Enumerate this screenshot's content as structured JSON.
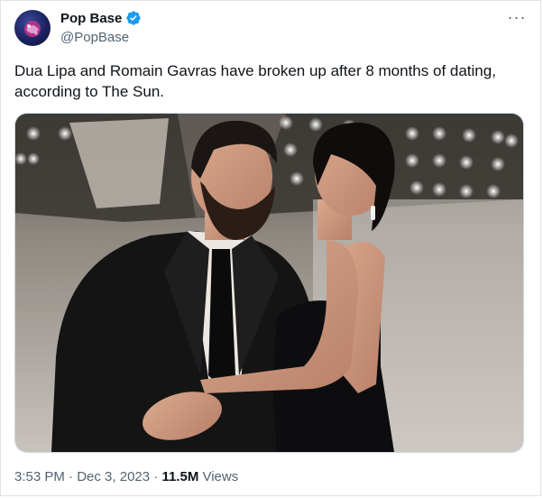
{
  "author": {
    "display_name": "Pop Base",
    "handle": "@PopBase",
    "verified": true,
    "verified_color": "#1d9bf0"
  },
  "menu": {
    "more_label": "···"
  },
  "tweet": {
    "text": "Dua Lipa and Romain Gavras have broken up after 8 months of dating, according to The Sun."
  },
  "media": {
    "subject": "photo of a bearded man in a black suit and a woman in a black backless dress posing on a red carpet"
  },
  "meta": {
    "time": "3:53 PM",
    "separator": " · ",
    "date": "Dec 3, 2023",
    "views_count": "11.5M",
    "views_label": " Views"
  }
}
